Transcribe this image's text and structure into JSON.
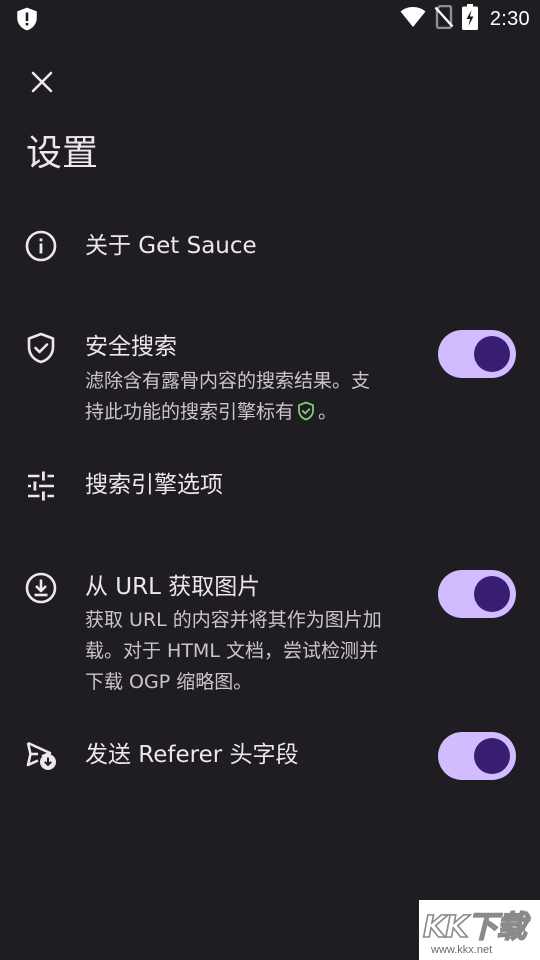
{
  "status_bar": {
    "time": "2:30",
    "icons": [
      "alert-shield-icon",
      "wifi-icon",
      "no-sim-icon",
      "battery-charging-icon"
    ]
  },
  "header": {
    "close_icon": "close-icon",
    "title": "设置"
  },
  "settings": {
    "about": {
      "icon": "info-icon",
      "title": "关于 Get Sauce"
    },
    "safe_search": {
      "icon": "shield-check-icon",
      "title": "安全搜索",
      "desc_line1": "滤除含有露骨内容的搜索结果。支",
      "desc_line2_before": "持此功能的搜索引擎标有",
      "desc_line2_after": "。",
      "toggle_on": true
    },
    "engine_options": {
      "icon": "tune-icon",
      "title": "搜索引擎选项"
    },
    "fetch_url": {
      "icon": "download-circle-icon",
      "title": "从 URL 获取图片",
      "desc_line1": "获取 URL 的内容并将其作为图片加",
      "desc_line2": "载。对于 HTML 文档，尝试检测并",
      "desc_line3": "下载 OGP 缩略图。",
      "toggle_on": true
    },
    "referer": {
      "icon": "send-referer-icon",
      "title": "发送 Referer 头字段",
      "toggle_on": true
    }
  },
  "colors": {
    "background": "#1f1d22",
    "switch_track": "#d0bcff",
    "switch_thumb": "#381e72",
    "safe_badge": "#7ccf7a"
  },
  "watermark": {
    "logo": "KK下载",
    "url": "www.kkx.net"
  }
}
